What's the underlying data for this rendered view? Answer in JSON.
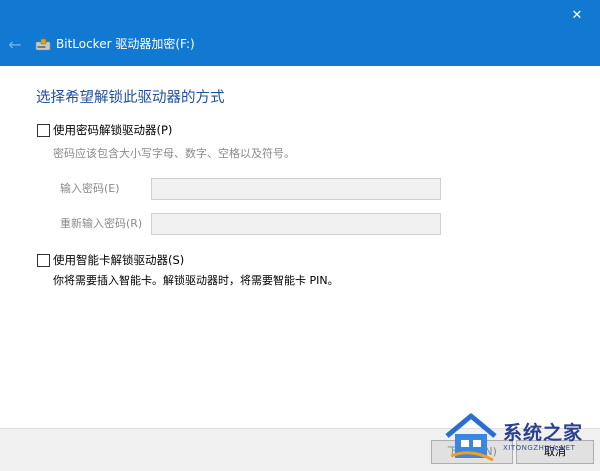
{
  "window": {
    "title": "BitLocker 驱动器加密(F:)",
    "close_glyph": "✕",
    "back_glyph": "←",
    "accent": "#1179d2"
  },
  "page": {
    "heading": "选择希望解锁此驱动器的方式"
  },
  "password_option": {
    "label": "使用密码解锁驱动器(P)",
    "checked": false,
    "hint": "密码应该包含大小写字母、数字、空格以及符号。",
    "enter_label": "输入密码(E)",
    "reenter_label": "重新输入密码(R)",
    "enter_value": "",
    "reenter_value": ""
  },
  "smartcard_option": {
    "label": "使用智能卡解锁驱动器(S)",
    "checked": false,
    "hint": "你将需要插入智能卡。解锁驱动器时，将需要智能卡 PIN。"
  },
  "footer": {
    "next_label": "下一步(N)",
    "cancel_label": "取消"
  },
  "watermark": {
    "text": "系统之家",
    "subtext": "XITONGZHIJIA.NET"
  }
}
